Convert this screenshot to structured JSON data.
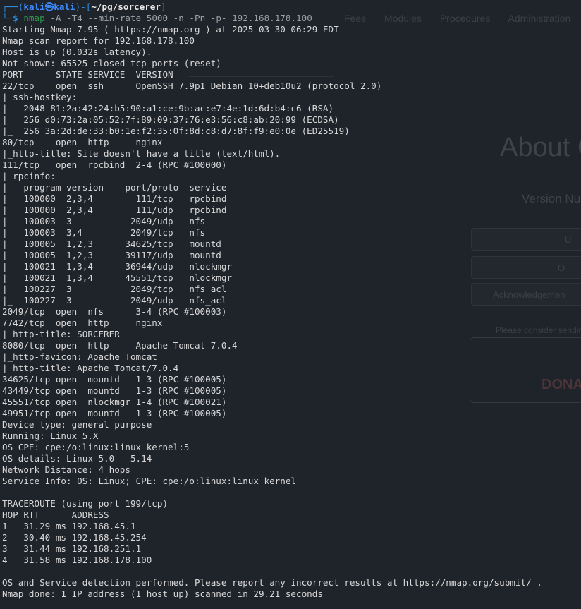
{
  "background_page": {
    "nav_items": [
      "Fees",
      "Modules",
      "Procedures",
      "Administration"
    ],
    "headline": "About C",
    "version_label": "Version Nu",
    "buttons": [
      "U",
      "O",
      "Acknowledgemen"
    ],
    "consider_text": "Please consider sendin",
    "donate_text": "DONA"
  },
  "terminal": {
    "prompt": {
      "user": "kali",
      "host": "kali",
      "path": "~/pg/sorcerer",
      "command_name": "nmap",
      "command_args": "-A -T4 --min-rate 5000 -n -Pn -p- 192.168.178.100"
    },
    "output_lines": [
      "Starting Nmap 7.95 ( https://nmap.org ) at 2025-03-30 06:29 EDT",
      "Nmap scan report for 192.168.178.100",
      "Host is up (0.032s latency).",
      "Not shown: 65525 closed tcp ports (reset)",
      "PORT      STATE SERVICE  VERSION",
      "22/tcp    open  ssh      OpenSSH 7.9p1 Debian 10+deb10u2 (protocol 2.0)",
      "| ssh-hostkey: ",
      "|   2048 81:2a:42:24:b5:90:a1:ce:9b:ac:e7:4e:1d:6d:b4:c6 (RSA)",
      "|   256 d0:73:2a:05:52:7f:89:09:37:76:e3:56:c8:ab:20:99 (ECDSA)",
      "|_  256 3a:2d:de:33:b0:1e:f2:35:0f:8d:c8:d7:8f:f9:e0:0e (ED25519)",
      "80/tcp    open  http     nginx",
      "|_http-title: Site doesn't have a title (text/html).",
      "111/tcp   open  rpcbind  2-4 (RPC #100000)",
      "| rpcinfo: ",
      "|   program version    port/proto  service",
      "|   100000  2,3,4        111/tcp   rpcbind",
      "|   100000  2,3,4        111/udp   rpcbind",
      "|   100003  3           2049/udp   nfs",
      "|   100003  3,4         2049/tcp   nfs",
      "|   100005  1,2,3      34625/tcp   mountd",
      "|   100005  1,2,3      39117/udp   mountd",
      "|   100021  1,3,4      36944/udp   nlockmgr",
      "|   100021  1,3,4      45551/tcp   nlockmgr",
      "|   100227  3           2049/tcp   nfs_acl",
      "|_  100227  3           2049/udp   nfs_acl",
      "2049/tcp  open  nfs      3-4 (RPC #100003)",
      "7742/tcp  open  http     nginx",
      "|_http-title: SORCERER",
      "8080/tcp  open  http     Apache Tomcat 7.0.4",
      "|_http-favicon: Apache Tomcat",
      "|_http-title: Apache Tomcat/7.0.4",
      "34625/tcp open  mountd   1-3 (RPC #100005)",
      "43449/tcp open  mountd   1-3 (RPC #100005)",
      "45551/tcp open  nlockmgr 1-4 (RPC #100021)",
      "49951/tcp open  mountd   1-3 (RPC #100005)",
      "Device type: general purpose",
      "Running: Linux 5.X",
      "OS CPE: cpe:/o:linux:linux_kernel:5",
      "OS details: Linux 5.0 - 5.14",
      "Network Distance: 4 hops",
      "Service Info: OS: Linux; CPE: cpe:/o:linux:linux_kernel",
      "",
      "TRACEROUTE (using port 199/tcp)",
      "HOP RTT      ADDRESS",
      "1   31.29 ms 192.168.45.1",
      "2   30.40 ms 192.168.45.254",
      "3   31.44 ms 192.168.251.1",
      "4   31.58 ms 192.168.178.100",
      "",
      "OS and Service detection performed. Please report any incorrect results at https://nmap.org/submit/ .",
      "Nmap done: 1 IP address (1 host up) scanned in 29.21 seconds"
    ]
  },
  "colors": {
    "terminal_background": "#1f232a",
    "prompt_blue": "#3d8bff",
    "command_green": "#2f9b4f",
    "text": "#d8d8d8"
  }
}
